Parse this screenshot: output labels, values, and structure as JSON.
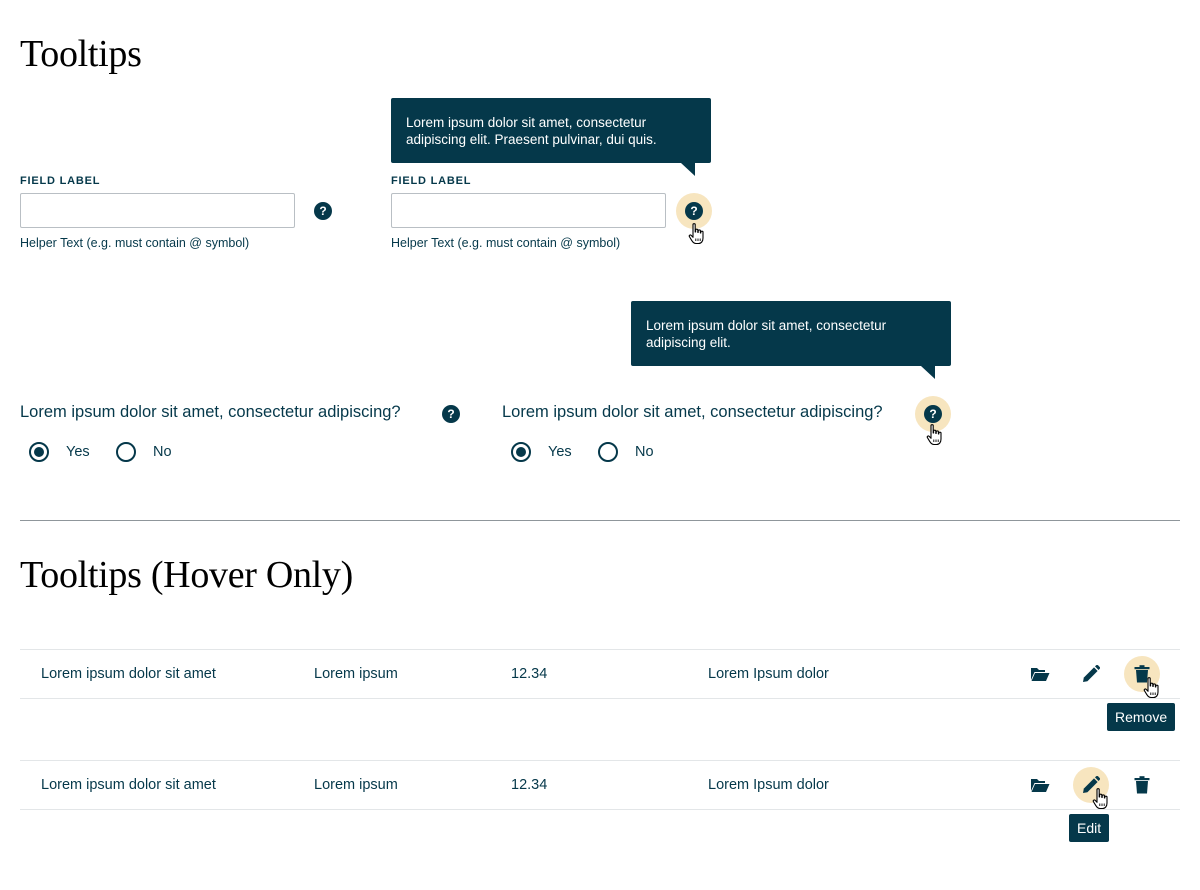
{
  "section1": {
    "title": "Tooltips"
  },
  "section2": {
    "title": "Tooltips (Hover Only)"
  },
  "fields": [
    {
      "label": "FIELD LABEL",
      "value": "",
      "helper": "Helper Text (e.g. must contain @ symbol)",
      "help_icon": "question-circle-icon",
      "tooltip_visible": false
    },
    {
      "label": "FIELD LABEL",
      "value": "",
      "helper": "Helper Text (e.g. must contain @ symbol)",
      "help_icon": "question-circle-icon",
      "tooltip_visible": true,
      "tooltip": "Lorem ipsum dolor sit amet, consectetur adipiscing elit. Praesent pulvinar, dui quis."
    }
  ],
  "questions": [
    {
      "text": "Lorem ipsum dolor sit amet, consectetur adipiscing?",
      "options": [
        "Yes",
        "No"
      ],
      "selected": "Yes",
      "tooltip_visible": false
    },
    {
      "text": "Lorem ipsum dolor sit amet, consectetur adipiscing?",
      "options": [
        "Yes",
        "No"
      ],
      "selected": "Yes",
      "tooltip_visible": true,
      "tooltip": "Lorem ipsum dolor sit amet, consectetur adipiscing elit."
    }
  ],
  "help_glyph": "?",
  "table": {
    "rows": [
      {
        "cells": [
          "Lorem ipsum dolor sit amet",
          "Lorem ipsum",
          "12.34",
          "Lorem Ipsum dolor"
        ],
        "hovered_action": "remove"
      },
      {
        "cells": [
          "Lorem ipsum dolor sit amet",
          "Lorem ipsum",
          "12.34",
          "Lorem Ipsum dolor"
        ],
        "hovered_action": "edit"
      }
    ],
    "actions": [
      {
        "id": "open",
        "icon": "folder-open-icon",
        "tooltip": ""
      },
      {
        "id": "edit",
        "icon": "pencil-icon",
        "tooltip": "Edit"
      },
      {
        "id": "remove",
        "icon": "trash-icon",
        "tooltip": "Remove"
      }
    ]
  },
  "colors": {
    "primary": "#05384a",
    "hover_highlight": "#f7e5bf",
    "divider": "#8f969b",
    "row_line": "#e3e6e8"
  }
}
